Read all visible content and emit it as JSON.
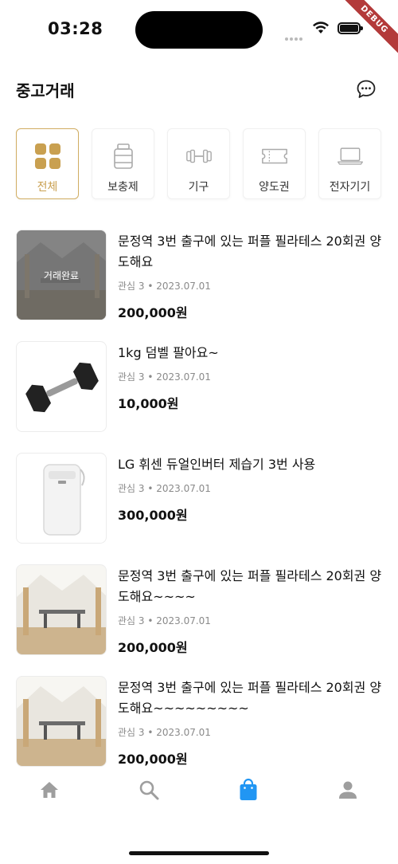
{
  "status_bar": {
    "time": "03:28",
    "debug_label": "DEBUG"
  },
  "header": {
    "title": "중고거래",
    "chat_icon": "chat-bubble-icon"
  },
  "categories": [
    {
      "label": "전체",
      "icon": "grid-icon",
      "active": true
    },
    {
      "label": "보충제",
      "icon": "supplement-jar-icon",
      "active": false
    },
    {
      "label": "기구",
      "icon": "dumbbell-icon",
      "active": false
    },
    {
      "label": "양도권",
      "icon": "ticket-icon",
      "active": false
    },
    {
      "label": "전자기기",
      "icon": "laptop-icon",
      "active": false
    }
  ],
  "products": [
    {
      "title": "문정역 3번 출구에 있는 퍼플 필라테스 20회권 양도해요",
      "meta": "관심 3 • 2023.07.01",
      "price": "200,000원",
      "badge": "거래완료",
      "image": "pilates-studio-photo"
    },
    {
      "title": "1kg 덤벨 팔아요~",
      "meta": "관심 3 • 2023.07.01",
      "price": "10,000원",
      "image": "dumbbell-photo"
    },
    {
      "title": "LG 휘센 듀얼인버터 제습기 3번 사용",
      "meta": "관심 3 • 2023.07.01",
      "price": "300,000원",
      "image": "dehumidifier-photo"
    },
    {
      "title": "문정역 3번 출구에 있는 퍼플 필라테스 20회권 양도해요~~~~",
      "meta": "관심 3 • 2023.07.01",
      "price": "200,000원",
      "image": "pilates-studio-photo"
    },
    {
      "title": "문정역 3번 출구에 있는 퍼플 필라테스 20회권 양도해요~~~~~~~~~",
      "meta": "관심 3 • 2023.07.01",
      "price": "200,000원",
      "image": "pilates-studio-photo"
    }
  ],
  "bottom_nav": [
    {
      "icon": "home-icon",
      "active": false
    },
    {
      "icon": "search-icon",
      "active": false
    },
    {
      "icon": "shopping-bag-icon",
      "active": true
    },
    {
      "icon": "person-icon",
      "active": false
    }
  ],
  "colors": {
    "accent_gold": "#c9a050",
    "nav_active": "#2196f3",
    "nav_inactive": "#9e9e9e"
  }
}
